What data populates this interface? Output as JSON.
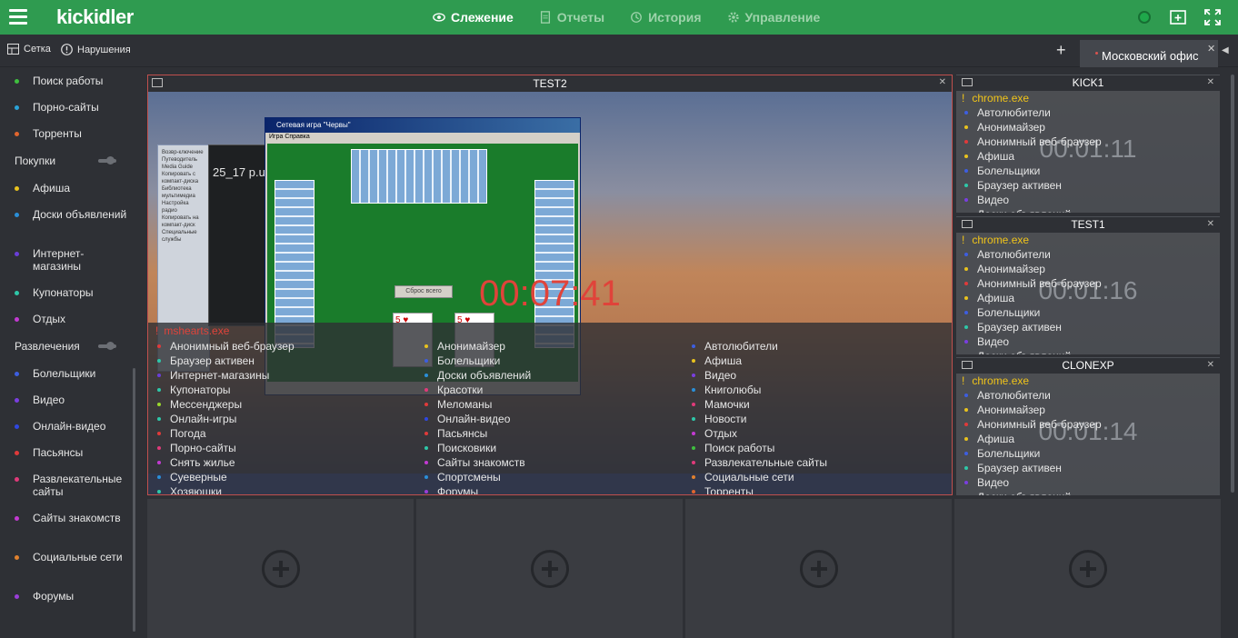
{
  "app": {
    "logo": "kickidler",
    "nav": [
      {
        "label": "Слежение",
        "icon": "eye-icon",
        "active": true
      },
      {
        "label": "Отчеты",
        "icon": "document-icon",
        "active": false
      },
      {
        "label": "История",
        "icon": "history-icon",
        "active": false
      },
      {
        "label": "Управление",
        "icon": "gear-icon",
        "active": false
      }
    ]
  },
  "subbar": {
    "grid_label": "Сетка",
    "violations_label": "Нарушения",
    "add_tab_label": "+",
    "office_tab": "Московский офис"
  },
  "sidebar": {
    "items_top": [
      {
        "label": "Поиск работы",
        "color": "#3fbf3f"
      },
      {
        "label": "Порно-сайты",
        "color": "#2aa3d8"
      },
      {
        "label": "Торренты",
        "color": "#e0652e"
      }
    ],
    "group_purchases": "Покупки",
    "items_purchases": [
      {
        "label": "Афиша",
        "color": "#e8c21e"
      },
      {
        "label": "Доски объявлений",
        "color": "#2a8fd8"
      },
      {
        "label": "Интернет-магазины",
        "color": "#6a3ed8"
      },
      {
        "label": "Купонаторы",
        "color": "#2ec7a8"
      },
      {
        "label": "Отдых",
        "color": "#c33ad2"
      }
    ],
    "group_entertainment": "Развлечения",
    "items_entertainment": [
      {
        "label": "Болельщики",
        "color": "#3d5ee0"
      },
      {
        "label": "Видео",
        "color": "#7a3ee0"
      },
      {
        "label": "Онлайн-видео",
        "color": "#2f47e0"
      },
      {
        "label": "Пасьянсы",
        "color": "#e03a3a"
      },
      {
        "label": "Развлекательные сайты",
        "color": "#e03a7a"
      },
      {
        "label": "Сайты знакомств",
        "color": "#c33ad2"
      },
      {
        "label": "Социальные сети",
        "color": "#e0812e"
      },
      {
        "label": "Форумы",
        "color": "#9a3ed8"
      }
    ]
  },
  "main_panel": {
    "title": "TEST2",
    "timer": "00:07:41",
    "process": "mshearts.exe",
    "screen": {
      "game_title": "Сетевая игра \"Червы\"",
      "game_menu": "Игра   Справка",
      "game_button": "Сброс всего",
      "media_text": "25_17 p.u",
      "explorer_text": "Возвр-ключение Путеводитель Media Guide Копировать с компакт-диска Библиотека мультимедиа Настройка радио Копировать на компакт-диск Специальные службы"
    },
    "categories_col1": [
      {
        "label": "Анонимный веб-браузер",
        "color": "#e03a3a"
      },
      {
        "label": "Браузер активен",
        "color": "#2ec7a8"
      },
      {
        "label": "Интернет-магазины",
        "color": "#6a3ed8"
      },
      {
        "label": "Купонаторы",
        "color": "#2ec7a8"
      },
      {
        "label": "Мессенджеры",
        "color": "#9ad82e"
      },
      {
        "label": "Онлайн-игры",
        "color": "#2ec7a8"
      },
      {
        "label": "Погода",
        "color": "#e03a3a"
      },
      {
        "label": "Порно-сайты",
        "color": "#e03a7a"
      },
      {
        "label": "Снять жилье",
        "color": "#c33ad2"
      },
      {
        "label": "Суеверные",
        "color": "#2a8fd8"
      },
      {
        "label": "Хозяюшки",
        "color": "#2ec7a8"
      }
    ],
    "categories_col2": [
      {
        "label": "Анонимайзер",
        "color": "#e8c21e"
      },
      {
        "label": "Болельщики",
        "color": "#3d5ee0"
      },
      {
        "label": "Доски объявлений",
        "color": "#2a8fd8"
      },
      {
        "label": "Красотки",
        "color": "#e03a7a"
      },
      {
        "label": "Меломаны",
        "color": "#e03a3a"
      },
      {
        "label": "Онлайн-видео",
        "color": "#2f47e0"
      },
      {
        "label": "Пасьянсы",
        "color": "#e03a3a"
      },
      {
        "label": "Поисковики",
        "color": "#2ec7a8"
      },
      {
        "label": "Сайты знакомств",
        "color": "#c33ad2"
      },
      {
        "label": "Спортсмены",
        "color": "#2a8fd8"
      },
      {
        "label": "Форумы",
        "color": "#9a3ed8"
      }
    ],
    "categories_col3": [
      {
        "label": "Автолюбители",
        "color": "#3d5ee0"
      },
      {
        "label": "Афиша",
        "color": "#e8c21e"
      },
      {
        "label": "Видео",
        "color": "#7a3ee0"
      },
      {
        "label": "Книголюбы",
        "color": "#2a8fd8"
      },
      {
        "label": "Мамочки",
        "color": "#e03a7a"
      },
      {
        "label": "Новости",
        "color": "#2ec7a8"
      },
      {
        "label": "Отдых",
        "color": "#c33ad2"
      },
      {
        "label": "Поиск работы",
        "color": "#3fbf3f"
      },
      {
        "label": "Развлекательные сайты",
        "color": "#e03a7a"
      },
      {
        "label": "Социальные сети",
        "color": "#e0812e"
      },
      {
        "label": "Торренты",
        "color": "#e0652e"
      }
    ]
  },
  "side_panels": [
    {
      "title": "KICK1",
      "timer": "00:01:11",
      "process": "chrome.exe",
      "categories": [
        {
          "label": "Автолюбители",
          "color": "#3d5ee0"
        },
        {
          "label": "Анонимайзер",
          "color": "#e8c21e"
        },
        {
          "label": "Анонимный веб-браузер",
          "color": "#e03a3a"
        },
        {
          "label": "Афиша",
          "color": "#e8c21e"
        },
        {
          "label": "Болельщики",
          "color": "#3d5ee0"
        },
        {
          "label": "Браузер активен",
          "color": "#2ec7a8"
        },
        {
          "label": "Видео",
          "color": "#7a3ee0"
        },
        {
          "label": "Доски объявлений",
          "color": "#2a8fd8"
        }
      ]
    },
    {
      "title": "TEST1",
      "timer": "00:01:16",
      "process": "chrome.exe",
      "categories": [
        {
          "label": "Автолюбители",
          "color": "#3d5ee0"
        },
        {
          "label": "Анонимайзер",
          "color": "#e8c21e"
        },
        {
          "label": "Анонимный веб-браузер",
          "color": "#e03a3a"
        },
        {
          "label": "Афиша",
          "color": "#e8c21e"
        },
        {
          "label": "Болельщики",
          "color": "#3d5ee0"
        },
        {
          "label": "Браузер активен",
          "color": "#2ec7a8"
        },
        {
          "label": "Видео",
          "color": "#7a3ee0"
        },
        {
          "label": "Доски объявлений",
          "color": "#2a8fd8"
        }
      ]
    },
    {
      "title": "CLONEXP",
      "timer": "00:01:14",
      "process": "chrome.exe",
      "categories": [
        {
          "label": "Автолюбители",
          "color": "#3d5ee0"
        },
        {
          "label": "Анонимайзер",
          "color": "#e8c21e"
        },
        {
          "label": "Анонимный веб-браузер",
          "color": "#e03a3a"
        },
        {
          "label": "Афиша",
          "color": "#e8c21e"
        },
        {
          "label": "Болельщики",
          "color": "#3d5ee0"
        },
        {
          "label": "Браузер активен",
          "color": "#2ec7a8"
        },
        {
          "label": "Видео",
          "color": "#7a3ee0"
        },
        {
          "label": "Доски объявлений",
          "color": "#2a8fd8"
        }
      ]
    }
  ]
}
